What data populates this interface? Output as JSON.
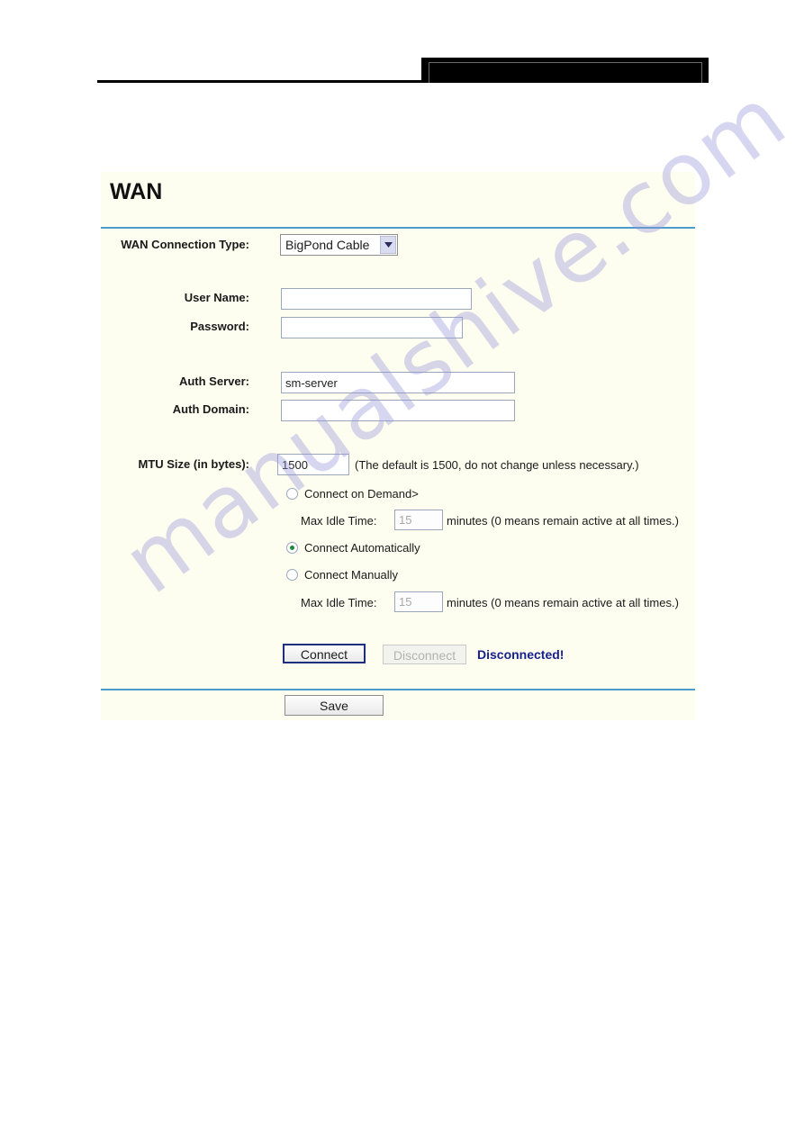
{
  "header": {
    "redaction_label": "redacted-header-block"
  },
  "panel": {
    "title": "WAN"
  },
  "form": {
    "connection_type": {
      "label": "WAN Connection Type:",
      "value": "BigPond Cable",
      "options": [
        "BigPond Cable"
      ]
    },
    "user_name": {
      "label": "User Name:",
      "value": "",
      "placeholder": ""
    },
    "password": {
      "label": "Password:",
      "value": "",
      "placeholder": ""
    },
    "auth_server": {
      "label": "Auth Server:",
      "value": "sm-server",
      "placeholder": ""
    },
    "auth_domain": {
      "label": "Auth Domain:",
      "value": "",
      "placeholder": ""
    },
    "mtu": {
      "label": "MTU Size (in bytes):",
      "value": "1500",
      "note": "(The default is 1500, do not change unless necessary.)"
    },
    "connect_mode": {
      "selected": "Connect Automatically",
      "options": [
        {
          "label": "Connect on Demand>",
          "checked": false
        },
        {
          "label": "Connect Automatically",
          "checked": true
        },
        {
          "label": "Connect Manually",
          "checked": false
        }
      ]
    },
    "idle_demand": {
      "label": "Max Idle Time:",
      "value": "15",
      "unit_note": "minutes (0 means remain active at all times.)"
    },
    "idle_manual": {
      "label": "Max Idle Time:",
      "value": "15",
      "unit_note": "minutes (0 means remain active at all times.)"
    }
  },
  "actions": {
    "connect_label": "Connect",
    "disconnect_label": "Disconnect",
    "status": "Disconnected!",
    "save_label": "Save"
  },
  "watermark": {
    "text": "manualshive.com"
  },
  "colors": {
    "panel_background": "#fdfdf0",
    "rule_blue": "#4a9ccc",
    "status_blue": "#16218c",
    "radio_dot_green": "#1f8a3c",
    "watermark": "#9694d7"
  }
}
